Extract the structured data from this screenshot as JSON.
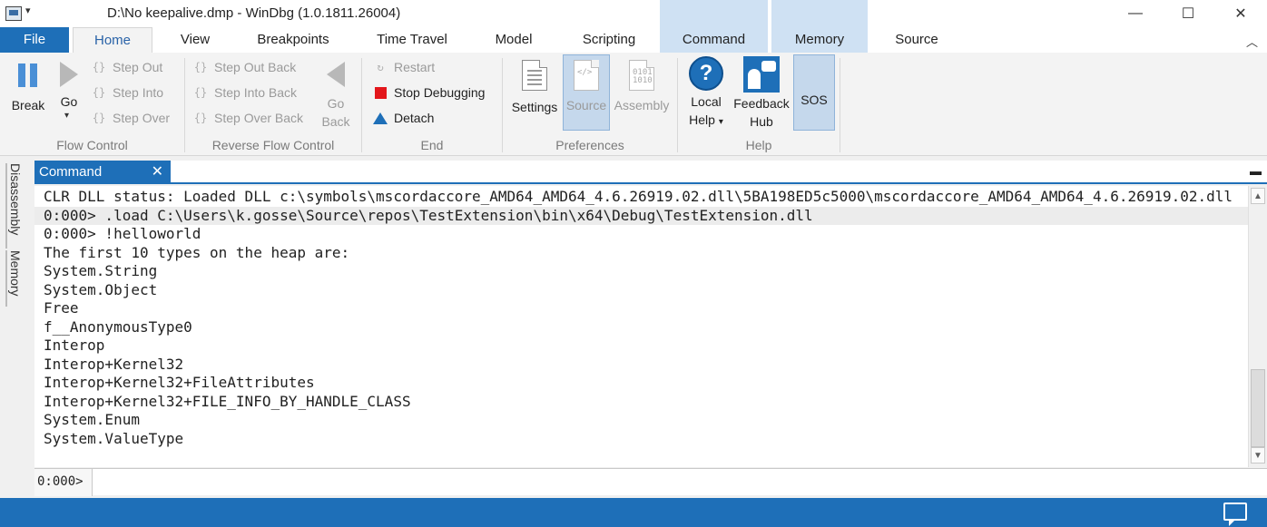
{
  "window": {
    "title": "D:\\No keepalive.dmp - WinDbg (1.0.1811.26004)",
    "dropdown_glyph": "▾",
    "minimize": "—",
    "maximize": "☐",
    "close": "✕"
  },
  "tabs": [
    "File",
    "Home",
    "View",
    "Breakpoints",
    "Time Travel",
    "Model",
    "Scripting",
    "Command",
    "Memory",
    "Source"
  ],
  "ribbon": {
    "flow_control": {
      "label": "Flow Control",
      "break": "Break",
      "go": "Go",
      "step_out": "Step Out",
      "step_into": "Step Into",
      "step_over": "Step Over"
    },
    "reverse_flow_control": {
      "label": "Reverse Flow Control",
      "step_out_back": "Step Out Back",
      "step_into_back": "Step Into Back",
      "step_over_back": "Step Over Back",
      "go_back_1": "Go",
      "go_back_2": "Back"
    },
    "end": {
      "label": "End",
      "restart": "Restart",
      "stop_debugging": "Stop Debugging",
      "detach": "Detach"
    },
    "preferences": {
      "label": "Preferences",
      "settings": "Settings",
      "source": "Source",
      "assembly": "Assembly"
    },
    "help": {
      "label": "Help",
      "local_help_1": "Local",
      "local_help_2": "Help",
      "feedback_hub_1": "Feedback",
      "feedback_hub_2": "Hub"
    },
    "sos": "SOS"
  },
  "side_tabs": [
    "Disassembly",
    "Memory"
  ],
  "command_window": {
    "tab_label": "Command",
    "close_glyph": "✕",
    "lines": [
      "CLR DLL status: Loaded DLL c:\\symbols\\mscordaccore_AMD64_AMD64_4.6.26919.02.dll\\5BA198ED5c5000\\mscordaccore_AMD64_AMD64_4.6.26919.02.dll",
      "0:000> .load C:\\Users\\k.gosse\\Source\\repos\\TestExtension\\bin\\x64\\Debug\\TestExtension.dll",
      "0:000> !helloworld",
      "The first 10 types on the heap are:",
      "System.String",
      "System.Object",
      "Free",
      "f__AnonymousType0",
      "Interop",
      "Interop+Kernel32",
      "Interop+Kernel32+FileAttributes",
      "Interop+Kernel32+FILE_INFO_BY_HANDLE_CLASS",
      "System.Enum",
      "System.ValueType"
    ],
    "prompt": "0:000>",
    "input_value": ""
  },
  "colors": {
    "accent": "#1e6fb8",
    "stop": "#e3161b",
    "context_tab": "#cfe1f3"
  }
}
